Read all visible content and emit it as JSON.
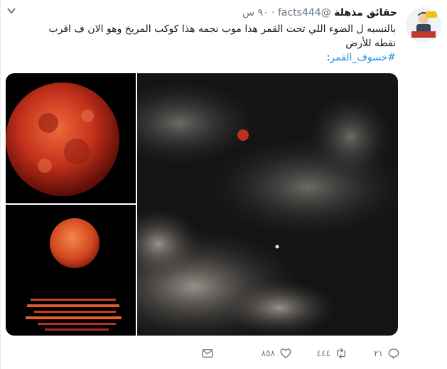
{
  "tweet": {
    "author_name": "حقائق مذهلة",
    "author_handle": "@facts444",
    "separator": "·",
    "time": "٩٠ س",
    "text": "بالنسبه ل الضوء اللي تحت القمر هذا موب نجمه هذا كوكب المريخ وهو الان ف اقرب نقطه للأرض",
    "hashtag": "#خسوف_القمر",
    "hashtag_suffix": ":"
  },
  "actions": {
    "reply_count": "٢١",
    "retweet_count": "٤٤٤",
    "like_count": "٨٥٨"
  },
  "icons": {
    "menu": "chevron-down-icon",
    "reply": "reply-icon",
    "retweet": "retweet-icon",
    "like": "heart-icon",
    "dm": "envelope-icon"
  },
  "colors": {
    "text": "#14171a",
    "secondary": "#657786",
    "link": "#1b95e0"
  }
}
